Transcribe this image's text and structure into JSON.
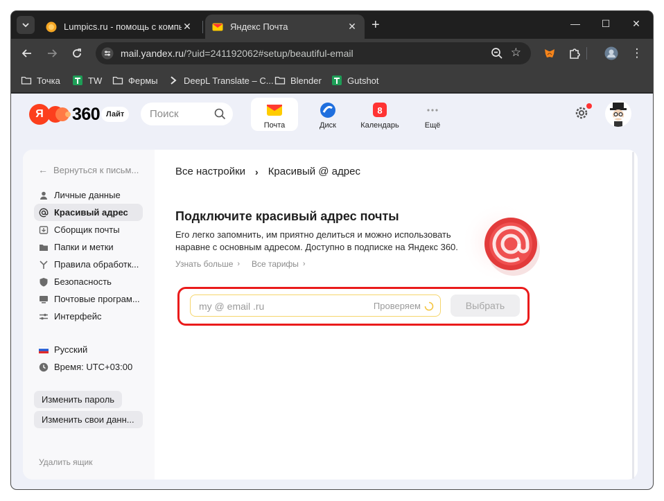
{
  "browser": {
    "tabs": [
      {
        "title": "Lumpics.ru - помощь с компьютером",
        "active": false
      },
      {
        "title": "Яндекс Почта",
        "active": true
      }
    ],
    "new_tab_label": "+",
    "address": {
      "host": "mail.yandex.ru",
      "path": "/?uid=241192062#setup/beautiful-email"
    },
    "bookmarks": [
      "Точка",
      "TW",
      "Фермы",
      "DeepL Translate – С...",
      "Blender",
      "Gutshot"
    ]
  },
  "header": {
    "logo_ya": "Я",
    "logo_number": "360",
    "plan_badge": "Лайт",
    "search_placeholder": "Поиск",
    "services": [
      {
        "label": "Почта",
        "icon": "mail-icon",
        "active": true
      },
      {
        "label": "Диск",
        "icon": "disk-icon",
        "active": false
      },
      {
        "label": "Календарь",
        "icon": "calendar-icon",
        "active": false,
        "badge": "8"
      },
      {
        "label": "Ещё",
        "icon": "more-icon",
        "active": false
      }
    ]
  },
  "sidebar": {
    "back_label": "Вернуться к письм...",
    "items": [
      {
        "label": "Личные данные",
        "icon": "person-icon",
        "active": false
      },
      {
        "label": "Красивый адрес",
        "icon": "at-icon",
        "active": true
      },
      {
        "label": "Сборщик почты",
        "icon": "collector-icon",
        "active": false
      },
      {
        "label": "Папки и метки",
        "icon": "folder-icon",
        "active": false
      },
      {
        "label": "Правила обработк...",
        "icon": "rules-icon",
        "active": false
      },
      {
        "label": "Безопасность",
        "icon": "shield-icon",
        "active": false
      },
      {
        "label": "Почтовые програм...",
        "icon": "mail-programs-icon",
        "active": false
      },
      {
        "label": "Интерфейс",
        "icon": "sliders-icon",
        "active": false
      }
    ],
    "language": "Русский",
    "time": "Время: UTC+03:00",
    "change_password": "Изменить пароль",
    "change_data": "Изменить свои данн...",
    "delete_box": "Удалить ящик"
  },
  "main": {
    "breadcrumb_root": "Все настройки",
    "breadcrumb_current": "Красивый @ адрес",
    "title": "Подключите красивый адрес почты",
    "description": "Его легко запомнить, им приятно делиться и можно использовать наравне с основным адресом. Доступно в подписке на Яндекс 360.",
    "learn_more": "Узнать больше",
    "all_plans": "Все тарифы",
    "email_placeholder": "my @ email .ru",
    "checking_label": "Проверяем",
    "choose_button": "Выбрать"
  },
  "colors": {
    "accent_red": "#ea1b1b",
    "yandex_red": "#fc3f1d",
    "page_bg": "#eef0f8"
  }
}
